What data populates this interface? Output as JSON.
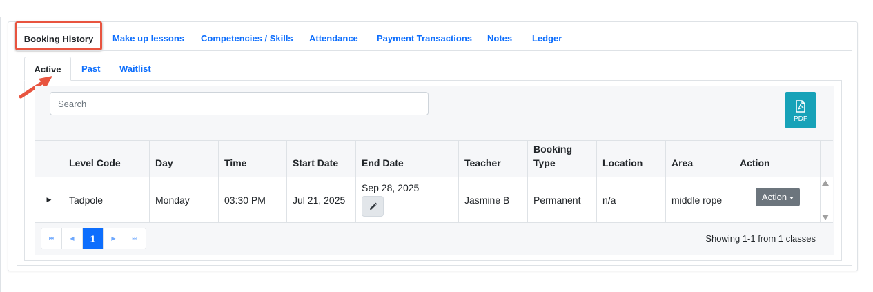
{
  "outer_tabs": [
    {
      "label": "Booking History",
      "active": true
    },
    {
      "label": "Make up lessons",
      "active": false
    },
    {
      "label": "Competencies / Skills",
      "active": false
    },
    {
      "label": "Attendance",
      "active": false
    },
    {
      "label": "Payment Transactions",
      "active": false
    },
    {
      "label": "Notes",
      "active": false
    },
    {
      "label": "Ledger",
      "active": false
    }
  ],
  "inner_tabs": [
    {
      "label": "Active",
      "active": true
    },
    {
      "label": "Past",
      "active": false
    },
    {
      "label": "Waitlist",
      "active": false
    }
  ],
  "search": {
    "placeholder": "Search",
    "value": ""
  },
  "pdf_button": {
    "label": "PDF",
    "icon": "pdf-file-icon"
  },
  "table": {
    "columns": [
      "Level Code",
      "Day",
      "Time",
      "Start Date",
      "End Date",
      "Teacher",
      "Booking Type",
      "Location",
      "Area",
      "Action"
    ],
    "rows": [
      {
        "level_code": "Tadpole",
        "day": "Monday",
        "time": "03:30 PM",
        "start_date": "Jul 21, 2025",
        "end_date": "Sep 28, 2025",
        "teacher": "Jasmine B",
        "booking_type": "Permanent",
        "location": "n/a",
        "area": "middle rope",
        "action_label": "Action"
      }
    ]
  },
  "pagination": {
    "first": "⏮",
    "prev": "◀",
    "current_page": "1",
    "next": "▶",
    "last": "⏭",
    "summary": "Showing 1-1 from 1 classes"
  },
  "colors": {
    "accent": "#0d6efd",
    "highlight": "#e8543f",
    "pdf_button": "#17a2b8",
    "action_button": "#6c757d"
  }
}
